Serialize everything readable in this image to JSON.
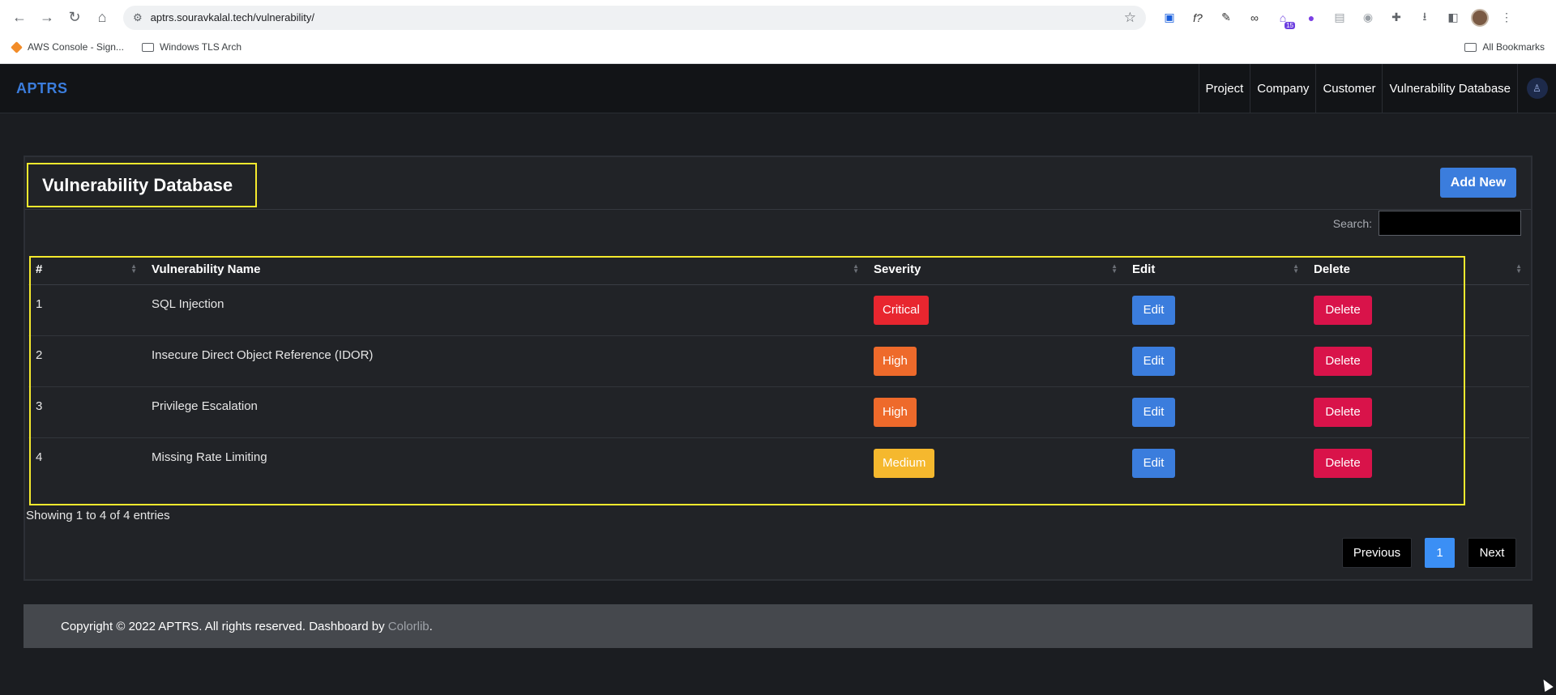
{
  "browser": {
    "url": "aptrs.souravkalal.tech/vulnerability/",
    "bookmarks": [
      {
        "label": "AWS Console - Sign..."
      },
      {
        "label": "Windows TLS Arch"
      }
    ],
    "all_bookmarks_label": "All Bookmarks",
    "extension_badge": "15"
  },
  "app": {
    "brand": "APTRS",
    "nav": [
      "Project",
      "Company",
      "Customer",
      "Vulnerability Database"
    ]
  },
  "card": {
    "title": "Vulnerability Database",
    "add_label": "Add New",
    "search_label": "Search:",
    "columns": [
      "#",
      "Vulnerability Name",
      "Severity",
      "Edit",
      "Delete"
    ],
    "rows": [
      {
        "num": "1",
        "name": "SQL Injection",
        "severity": "Critical",
        "edit": "Edit",
        "delete": "Delete"
      },
      {
        "num": "2",
        "name": "Insecure Direct Object Reference (IDOR)",
        "severity": "High",
        "edit": "Edit",
        "delete": "Delete"
      },
      {
        "num": "3",
        "name": "Privilege Escalation",
        "severity": "High",
        "edit": "Edit",
        "delete": "Delete"
      },
      {
        "num": "4",
        "name": "Missing Rate Limiting",
        "severity": "Medium",
        "edit": "Edit",
        "delete": "Delete"
      }
    ],
    "info": "Showing 1 to 4 of 4 entries",
    "pager": {
      "prev": "Previous",
      "current": "1",
      "next": "Next"
    }
  },
  "footer": {
    "text": "Copyright © 2022 APTRS. All rights reserved. Dashboard by ",
    "link": "Colorlib",
    "suffix": "."
  },
  "colors": {
    "accent": "#3b7ddd",
    "critical": "#e8262f",
    "high": "#ee6a2b",
    "medium": "#f5b82e",
    "delete": "#d9134a",
    "highlight": "#f5e92d"
  }
}
